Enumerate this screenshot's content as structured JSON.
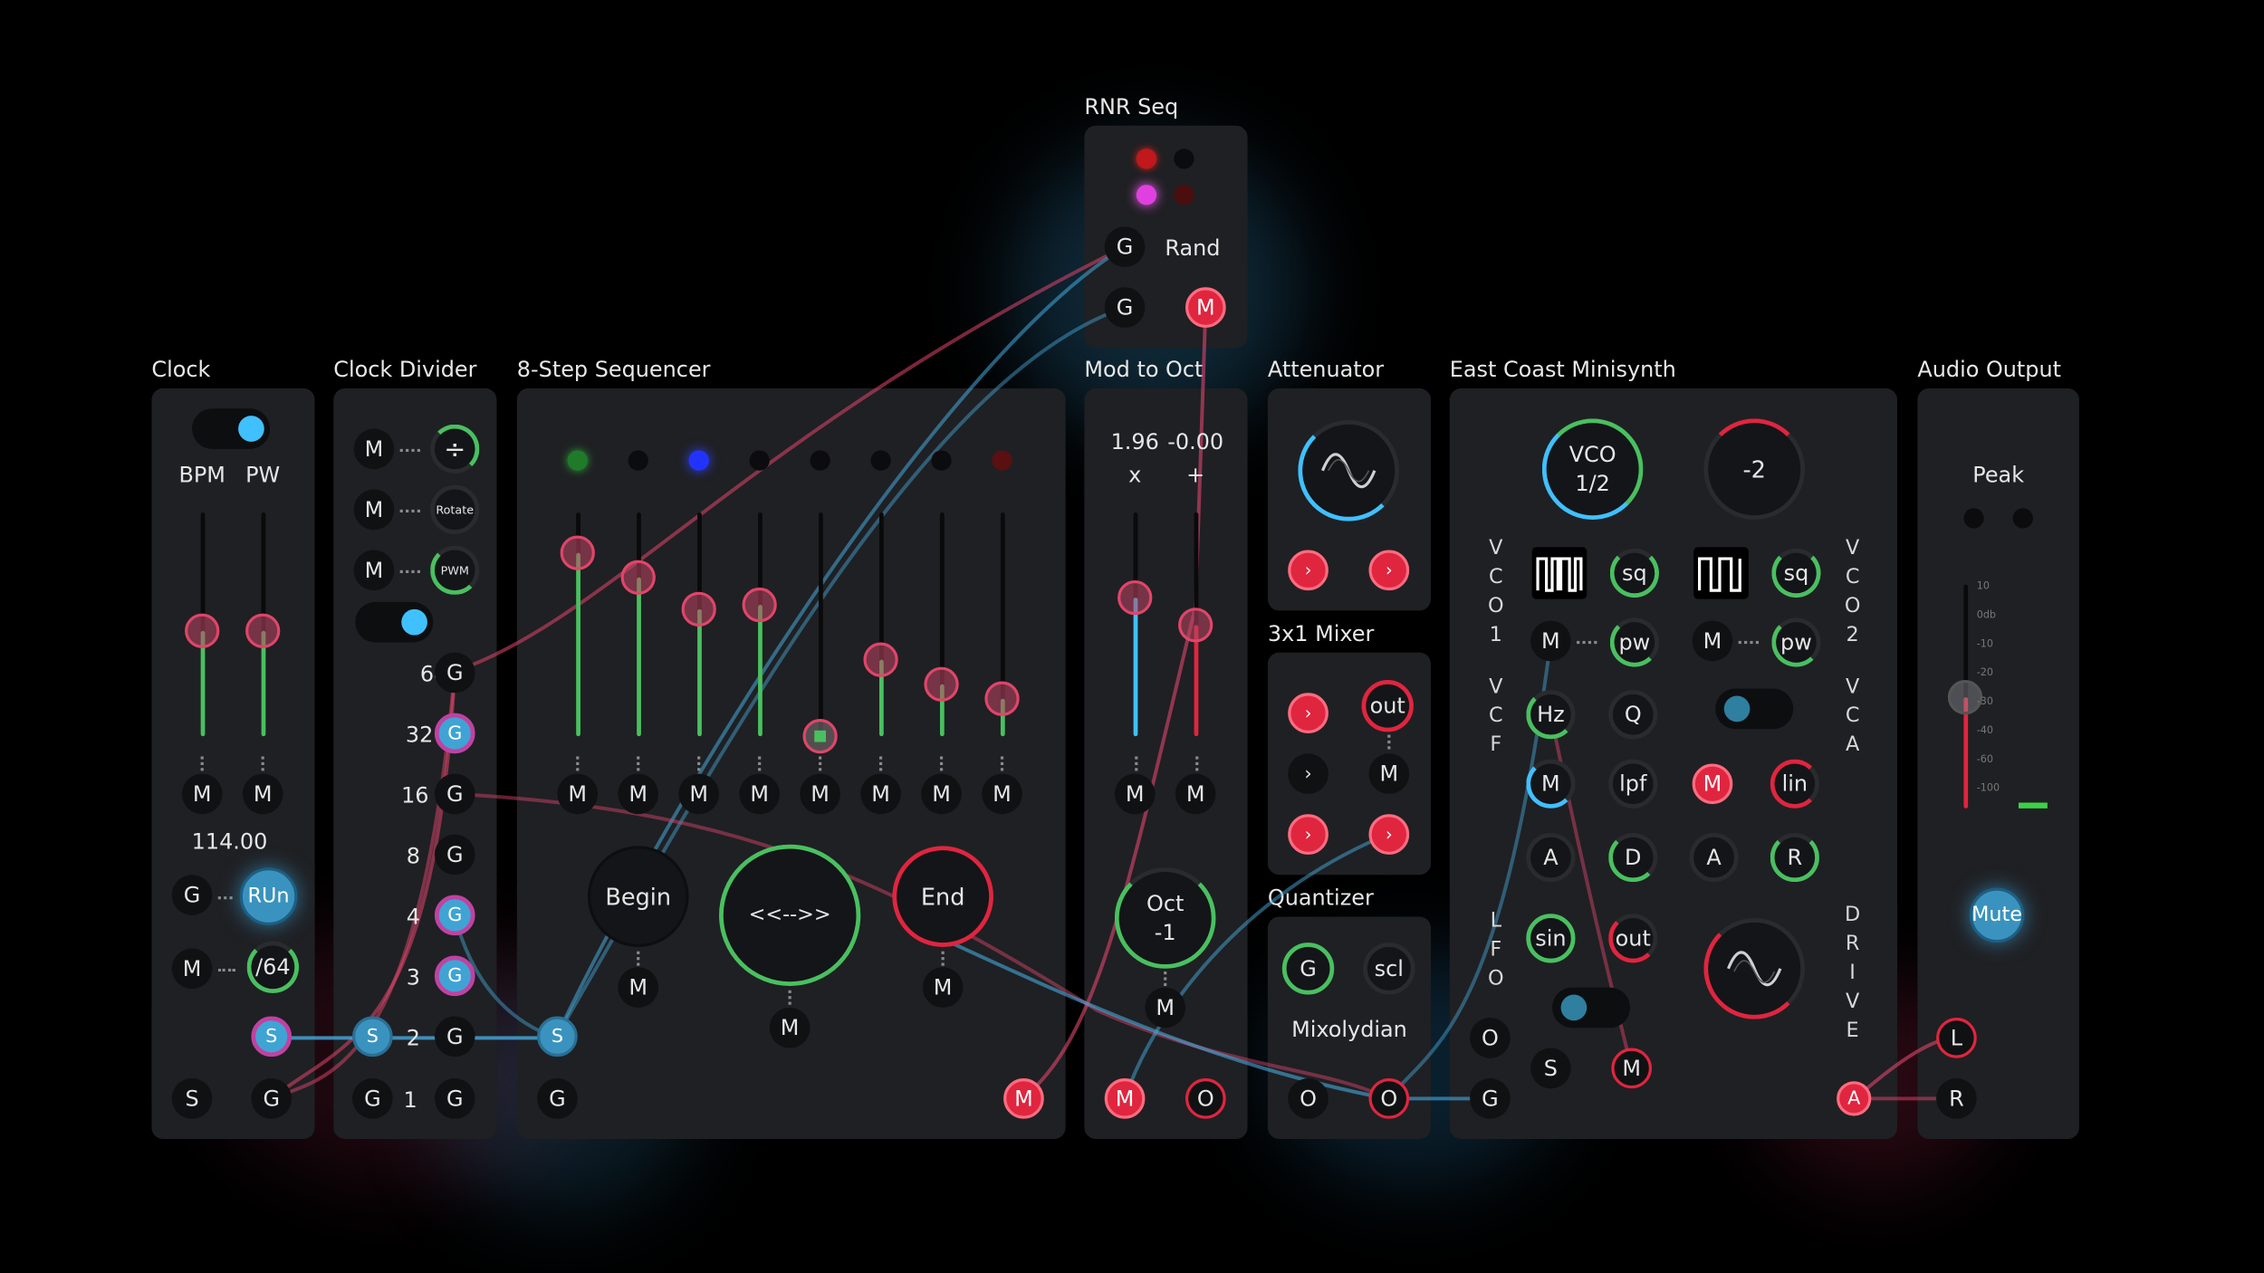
{
  "clock": {
    "title": "Clock",
    "bpm_label": "BPM",
    "pw_label": "PW",
    "bpm_mod": "M",
    "pw_mod": "M",
    "tempo_value": "114.00",
    "gate_in": "G",
    "run_button": "RUn",
    "mod_in": "M",
    "division_value": "/64",
    "sync_in": "S",
    "sync_out": "S",
    "s_jack": "S",
    "g_out": "G"
  },
  "clock_divider": {
    "title": "Clock Divider",
    "rows": [
      {
        "mod": "M",
        "knob": "÷"
      },
      {
        "mod": "M",
        "knob": "Rotate"
      },
      {
        "mod": "M",
        "knob": "PWM"
      }
    ],
    "outputs": [
      {
        "label": "64",
        "jack": "G"
      },
      {
        "label": "32",
        "jack": "G"
      },
      {
        "label": "16",
        "jack": "G"
      },
      {
        "label": "8",
        "jack": "G"
      },
      {
        "label": "4",
        "jack": "G"
      },
      {
        "label": "3",
        "jack": "G"
      },
      {
        "label": "2",
        "jack": "G"
      },
      {
        "label": "1",
        "jack": "G"
      }
    ],
    "sync_in": "S",
    "gate_in": "G"
  },
  "sequencer": {
    "title": "8-Step Sequencer",
    "step_values": [
      0.82,
      0.71,
      0.57,
      0.59,
      0.0,
      0.34,
      0.23,
      0.17
    ],
    "mod_labels": [
      "M",
      "M",
      "M",
      "M",
      "M",
      "M",
      "M",
      "M"
    ],
    "begin_label": "Begin",
    "direction_label": "<<-->>",
    "end_label": "End",
    "begin_mod": "M",
    "direction_mod": "M",
    "end_mod": "M",
    "sync_in": "S",
    "gate_in": "G",
    "mod_out": "M"
  },
  "rnr_seq": {
    "title": "RNR Seq",
    "gate1": "G",
    "rand_label": "Rand",
    "gate2": "G",
    "mod_out": "M"
  },
  "mod_to_oct": {
    "title": "Mod to Oct",
    "scale_value": "1.96",
    "offset_value": "-0.00",
    "scale_op": "x",
    "offset_op": "+",
    "scale_level": 0.62,
    "offset_level": 0.5,
    "mod1": "M",
    "mod2": "M",
    "oct_label": "Oct",
    "oct_value": "-1",
    "oct_mod": "M",
    "mod_in": "M",
    "oct_out": "O"
  },
  "attenuator": {
    "title": "Attenuator"
  },
  "mixer": {
    "title": "3x1 Mixer",
    "out_label": "out",
    "mod_label": "M"
  },
  "quantizer": {
    "title": "Quantizer",
    "gate_label": "G",
    "scale_label": "scl",
    "scale_name": "Mixolydian",
    "oct_in": "O",
    "oct_out": "O"
  },
  "minisynth": {
    "title": "East Coast Minisynth",
    "vco_knob_line1": "VCO",
    "vco_knob_line2": "1/2",
    "octave_value": "-2",
    "vco1_letters": [
      "V",
      "C",
      "O",
      "1"
    ],
    "vco2_letters": [
      "V",
      "C",
      "O",
      "2"
    ],
    "vcf_letters": [
      "V",
      "C",
      "F"
    ],
    "vca_letters": [
      "V",
      "C",
      "A"
    ],
    "lfo_letters": [
      "L",
      "F",
      "O"
    ],
    "drive_letters": [
      "D",
      "R",
      "I",
      "V",
      "E"
    ],
    "vco1_wave": "sq",
    "vco2_wave": "sq",
    "vco1_mod": "M",
    "vco1_pw": "pw",
    "vco2_mod": "M",
    "vco2_pw": "pw",
    "vcf_hz": "Hz",
    "vcf_q": "Q",
    "vcf_mod": "M",
    "vcf_type": "lpf",
    "vca_mod": "M",
    "vca_curve": "lin",
    "env1_a": "A",
    "env1_d": "D",
    "env2_a": "A",
    "env2_r": "R",
    "lfo_shape": "sin",
    "lfo_out": "out",
    "oct_in": "O",
    "gate_in": "G",
    "sync": "S",
    "mod": "M",
    "audio_out": "A"
  },
  "audio_output": {
    "title": "Audio Output",
    "peak_label": "Peak",
    "meter_scale": [
      "10",
      "0db",
      "-10",
      "-20",
      "-30",
      "-40",
      "-60",
      "-100"
    ],
    "mute_button": "Mute",
    "left_in": "L",
    "right_in": "R"
  },
  "colors": {
    "background": "#000000",
    "panel": "#1f2023",
    "accent_cyan": "#40c0ff",
    "accent_red": "#e0253f",
    "accent_green": "#4ac060",
    "accent_pink": "#c042a2"
  }
}
